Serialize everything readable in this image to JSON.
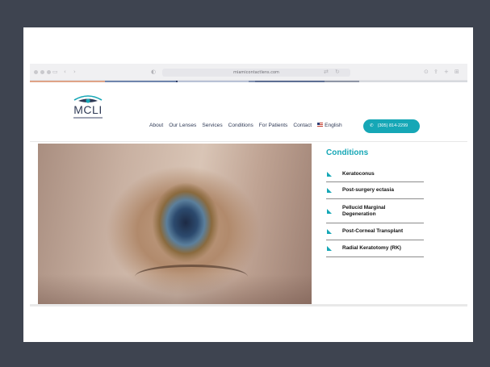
{
  "browser": {
    "url": "miamicontactlens.com",
    "progress_colors": [
      "#e0a487",
      "#6f85ad",
      "#2e3d66",
      "#b9c2d6",
      "#7f8fb0",
      "#5d6e93",
      "#8e95a6",
      "#d7d9de"
    ]
  },
  "header": {
    "logo_text": "MCLI",
    "nav": [
      "About",
      "Our Lenses",
      "Services",
      "Conditions",
      "For Patients",
      "Contact"
    ],
    "language": "English",
    "phone": "(305) 814-2299",
    "accent_color": "#16a7b6"
  },
  "conditions": {
    "title": "Conditions",
    "items": [
      "Keratoconus",
      "Post-surgery ectasia",
      "Pellucid Marginal Degeneration",
      "Post-Corneal Transplant",
      "Radial Keratotomy (RK)"
    ]
  }
}
